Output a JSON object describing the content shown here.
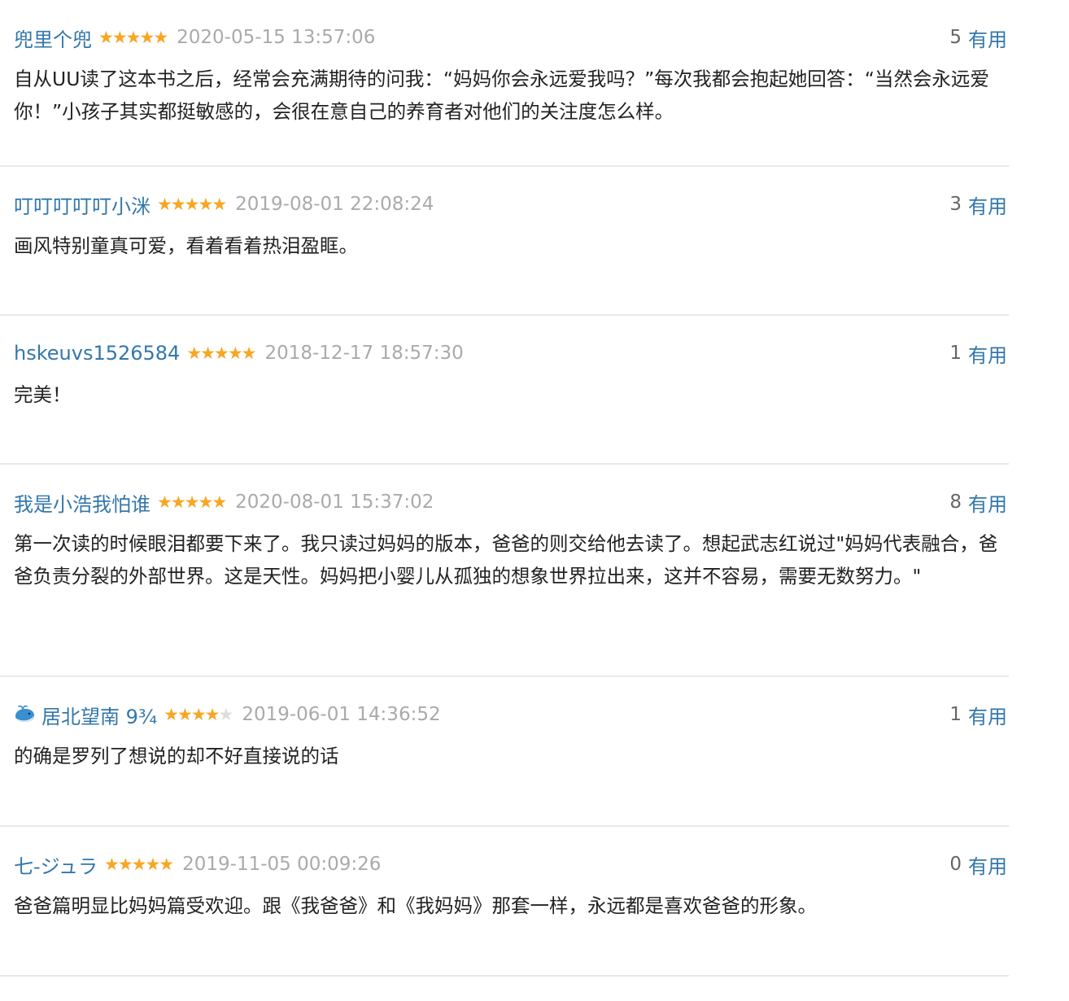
{
  "star_colors": {
    "on": "#f8a623",
    "off": "#dddddd"
  },
  "link_color": "#3377aa",
  "reviews": [
    {
      "username": "兜里个兜",
      "rating_stars": 5,
      "time": "2020-05-15 13:57:06",
      "votes": "5",
      "useful_label": "有用",
      "text": "自从UU读了这本书之后，经常会充满期待的问我：“妈妈你会永远爱我吗？”每次我都会抱起她回答：“当然会永远爱你！”小孩子其实都挺敏感的，会很在意自己的养育者对他们的关注度怎么样。"
    },
    {
      "username": "叮叮叮叮叮小洣",
      "rating_stars": 5,
      "time": "2019-08-01 22:08:24",
      "votes": "3",
      "useful_label": "有用",
      "text": "画风特别童真可爱，看着看着热泪盈眶。"
    },
    {
      "username": "hskeuvs1526584",
      "rating_stars": 5,
      "time": "2018-12-17 18:57:30",
      "votes": "1",
      "useful_label": "有用",
      "text": "完美！"
    },
    {
      "username": "我是小浩我怕谁",
      "rating_stars": 5,
      "time": "2020-08-01 15:37:02",
      "votes": "8",
      "useful_label": "有用",
      "text": "第一次读的时候眼泪都要下来了。我只读过妈妈的版本，爸爸的则交给他去读了。想起武志红说过\"妈妈代表融合，爸爸负责分裂的外部世界。这是天性。妈妈把小婴儿从孤独的想象世界拉出来，这并不容易，需要无数努力。\""
    },
    {
      "username": "居北望南 9¾",
      "avatar_icon": "whale-icon",
      "rating_stars": 4,
      "time": "2019-06-01 14:36:52",
      "votes": "1",
      "useful_label": "有用",
      "text": "的确是罗列了想说的却不好直接说的话"
    },
    {
      "username": "七-ジュラ",
      "rating_stars": 5,
      "time": "2019-11-05 00:09:26",
      "votes": "0",
      "useful_label": "有用",
      "text": "爸爸篇明显比妈妈篇受欢迎。跟《我爸爸》和《我妈妈》那套一样，永远都是喜欢爸爸的形象。"
    }
  ]
}
